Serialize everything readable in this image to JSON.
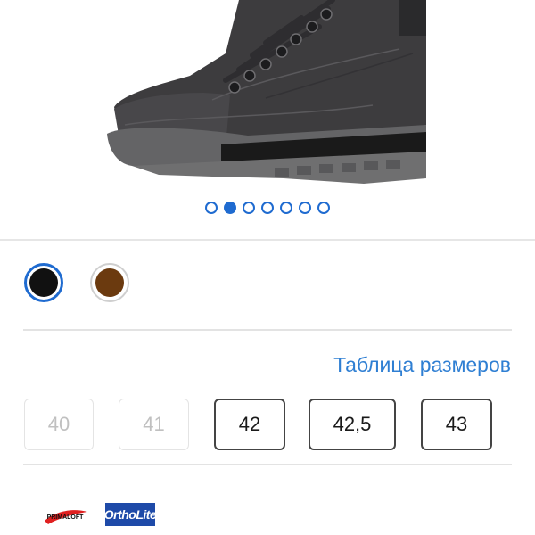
{
  "gallery": {
    "image_alt": "boot",
    "slide_count": 7,
    "active_slide": 2
  },
  "colors": {
    "options": [
      {
        "name": "black",
        "hex": "#111111",
        "selected": true
      },
      {
        "name": "brown",
        "hex": "#6b3a0f",
        "selected": false
      }
    ],
    "accent": "#1f6bd0"
  },
  "sizes": {
    "chart_link": "Таблица размеров",
    "options": [
      {
        "label": "40",
        "available": false
      },
      {
        "label": "41",
        "available": false
      },
      {
        "label": "42",
        "available": true
      },
      {
        "label": "42,5",
        "available": true
      },
      {
        "label": "43",
        "available": true
      }
    ]
  },
  "brands": {
    "primaloft": "PRIMALOFT",
    "ortholite": "OrthoLite"
  }
}
